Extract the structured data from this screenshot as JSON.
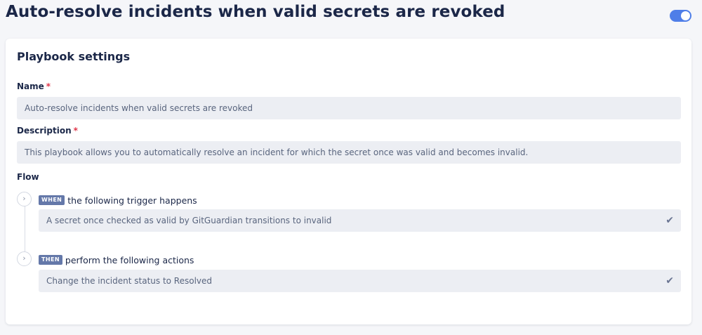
{
  "page": {
    "title": "Auto-resolve incidents when valid secrets are revoked",
    "enabled": true,
    "accent_color": "#4f7ee8"
  },
  "card": {
    "title": "Playbook settings",
    "name": {
      "label": "Name",
      "required_mark": "*",
      "value": "Auto-resolve incidents when valid secrets are revoked"
    },
    "description": {
      "label": "Description",
      "required_mark": "*",
      "value": "This playbook allows you to automatically resolve an incident for which the secret once was valid and becomes invalid."
    },
    "flow": {
      "label": "Flow",
      "steps": [
        {
          "expand_icon": "chevron-right-icon",
          "badge": "WHEN",
          "heading": "the following trigger happens",
          "value": "A secret once checked as valid by GitGuardian transitions to invalid",
          "status_icon": "check-icon"
        },
        {
          "expand_icon": "chevron-right-icon",
          "badge": "THEN",
          "heading": "perform the following actions",
          "value": "Change the incident status to Resolved",
          "status_icon": "check-icon"
        }
      ]
    }
  }
}
